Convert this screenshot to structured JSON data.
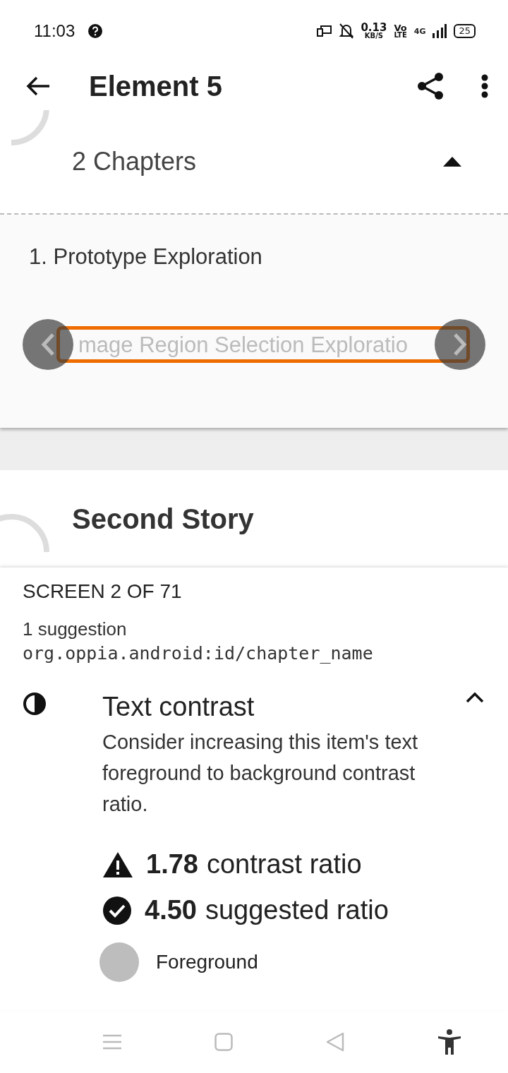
{
  "status_bar": {
    "time": "11:03",
    "speed_value": "0.13",
    "speed_unit": "KB/S",
    "volte_top": "Vo",
    "volte_bottom": "LTE",
    "network": "4G",
    "battery": "25"
  },
  "app_bar": {
    "title": "Element 5"
  },
  "chapters_section": {
    "title": "2 Chapters",
    "expanded": true,
    "chapters": [
      {
        "title": "1. Prototype Exploration",
        "highlighted": false
      },
      {
        "title": "mage Region Selection Exploratio",
        "highlighted": true
      }
    ]
  },
  "story": {
    "title": "Second Story"
  },
  "sheet": {
    "screen_label": "SCREEN 2 OF 71",
    "suggestion_count": "1 suggestion",
    "element_id": "org.oppia.android:id/chapter_name",
    "check": {
      "title": "Text contrast",
      "expanded": true,
      "description": "Consider increasing this item's text foreground to background contrast ratio.",
      "ratios": [
        {
          "kind": "warning",
          "value": "1.78",
          "label": "contrast ratio"
        },
        {
          "kind": "ok",
          "value": "4.50",
          "label": "suggested ratio"
        }
      ],
      "color_label": "Foreground"
    }
  }
}
